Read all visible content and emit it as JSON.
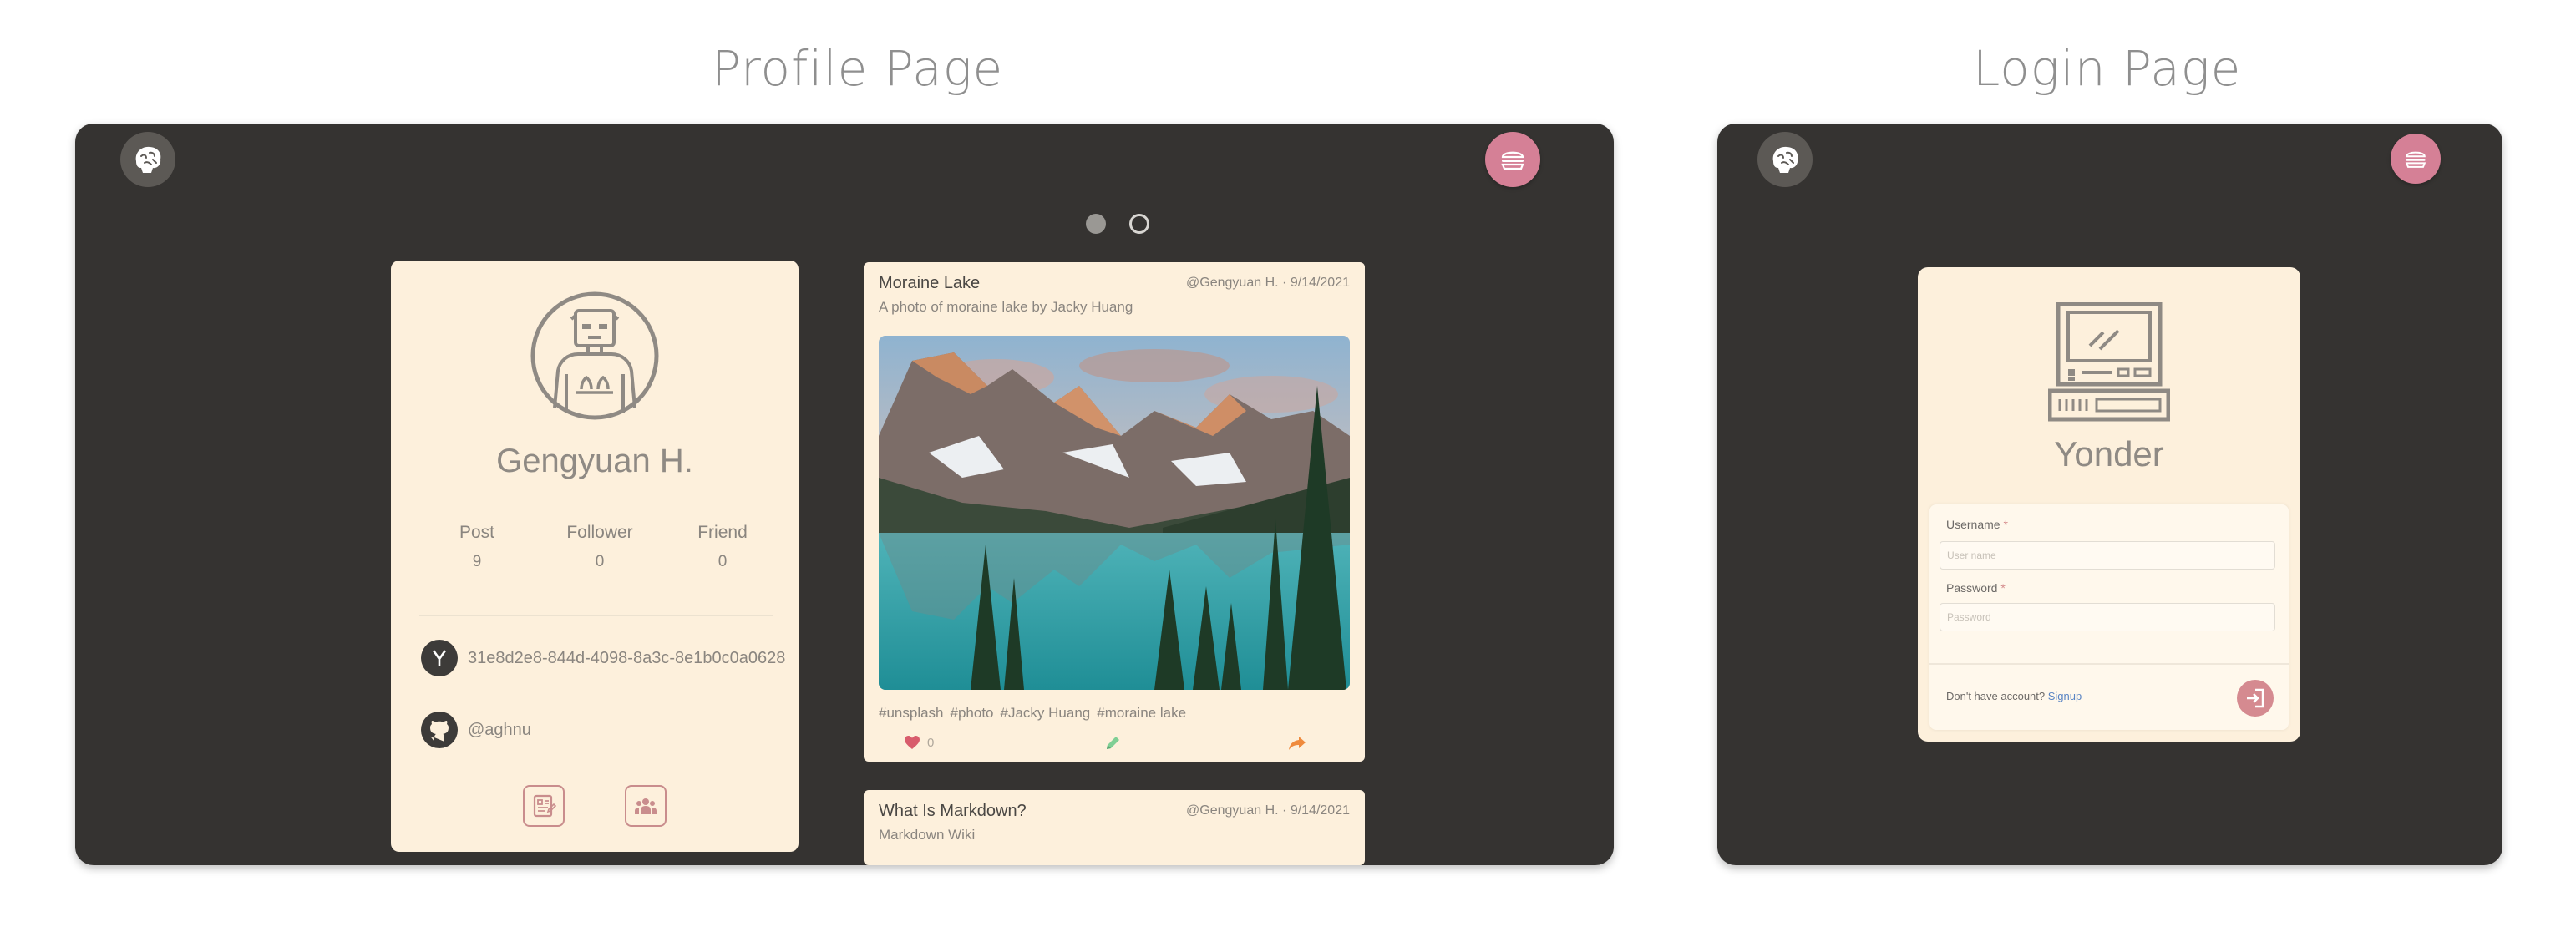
{
  "sections": {
    "profile_title": "Profile Page",
    "login_title": "Login Page"
  },
  "profile": {
    "name": "Gengyuan H.",
    "stats": [
      {
        "label": "Post",
        "value": "9"
      },
      {
        "label": "Follower",
        "value": "0"
      },
      {
        "label": "Friend",
        "value": "0"
      }
    ],
    "id_value": "31e8d2e8-844d-4098-8a3c-8e1b0c0a0628",
    "github": "@aghnu",
    "icons": {
      "id": "y-combinator-icon",
      "github": "github-icon",
      "posts": "posts-icon",
      "friends": "friends-icon",
      "avatar": "avatar-icon"
    }
  },
  "carousel": {
    "count": 2,
    "active_index": 0
  },
  "posts": [
    {
      "title": "Moraine Lake",
      "author": "@Gengyuan H.",
      "date": "9/14/2021",
      "separator": "·",
      "subtitle": "A photo of moraine lake by Jacky Huang",
      "tags": [
        "#unsplash",
        "#photo",
        "#Jacky Huang",
        "#moraine lake"
      ],
      "likes": "0"
    },
    {
      "title": "What Is Markdown?",
      "author": "@Gengyuan H.",
      "date": "9/14/2021",
      "separator": "·",
      "subtitle": "Markdown Wiki"
    }
  ],
  "login": {
    "brand": "Yonder",
    "username_label": "Username",
    "username_placeholder": "User name",
    "password_label": "Password",
    "password_placeholder": "Password",
    "required_mark": "*",
    "signup_prompt": "Don't have account?",
    "signup_link": "Signup"
  },
  "colors": {
    "window_bg": "#353331",
    "card_bg": "#fdf0dc",
    "accent_pink": "#d58096",
    "link_blue": "#5a85c4"
  }
}
